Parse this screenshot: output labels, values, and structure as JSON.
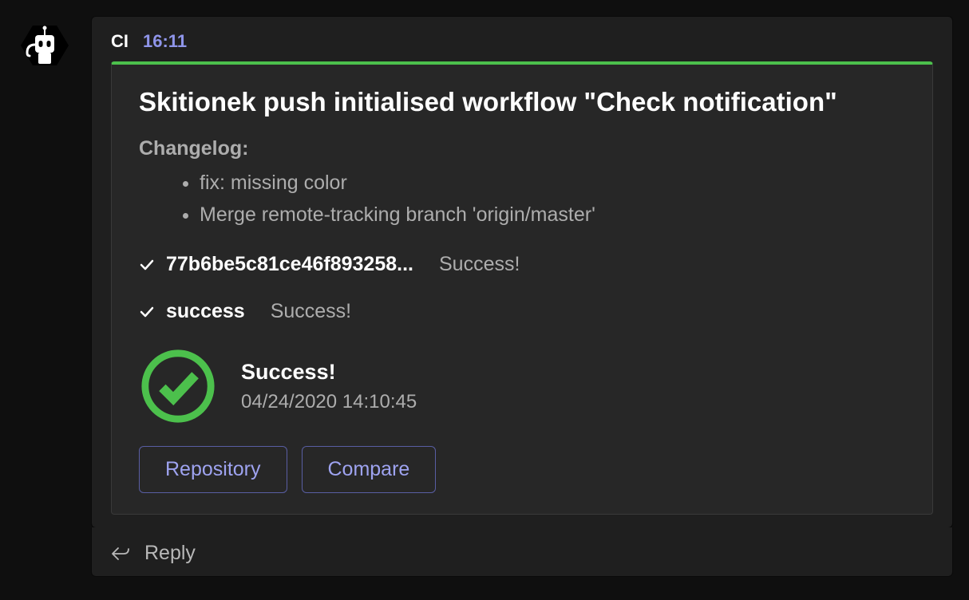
{
  "sender": "CI",
  "timestamp": "16:11",
  "card": {
    "title": "Skitionek push initialised workflow \"Check notification\"",
    "changelog_label": "Changelog:",
    "changelog": [
      "fix: missing color",
      "Merge remote-tracking branch 'origin/master'"
    ],
    "lines": [
      {
        "primary": "77b6be5c81ce46f893258...",
        "secondary": "Success!"
      },
      {
        "primary": "success",
        "secondary": "Success!"
      }
    ],
    "result": {
      "main": "Success!",
      "datetime": "04/24/2020 14:10:45"
    },
    "buttons": {
      "repository": "Repository",
      "compare": "Compare"
    }
  },
  "reply_placeholder": "Reply",
  "colors": {
    "accent_green": "#4cc04c",
    "link_purple": "#9ea3f0"
  }
}
